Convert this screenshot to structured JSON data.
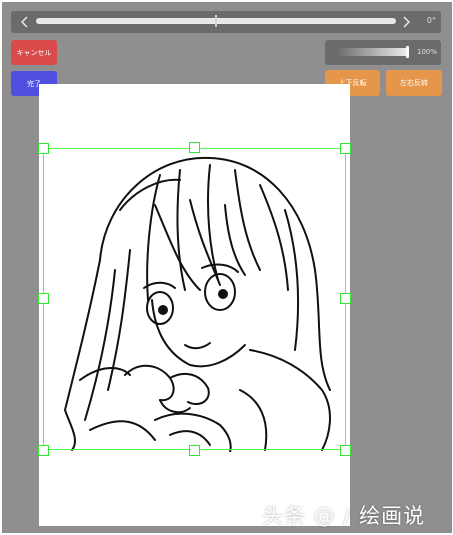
{
  "toolbar": {
    "rotation_readout": "0°",
    "rotation_degrees": 0,
    "opacity_readout": "100%",
    "opacity_fraction": 1.0
  },
  "buttons": {
    "cancel_label": "キャンセル",
    "done_label": "完了",
    "flip_vertical_label": "上下反転",
    "flip_horizontal_label": "左右反转"
  },
  "icons": {
    "rotate_left": "chevron-left-icon",
    "rotate_right": "chevron-right-icon"
  },
  "colors": {
    "cancel": "#d94a4a",
    "done": "#4f4fe0",
    "flip": "#e5964a",
    "selection": "#4dff4d",
    "workspace": "#8f8f8f"
  },
  "watermark": "头条 @ / 绘画说"
}
